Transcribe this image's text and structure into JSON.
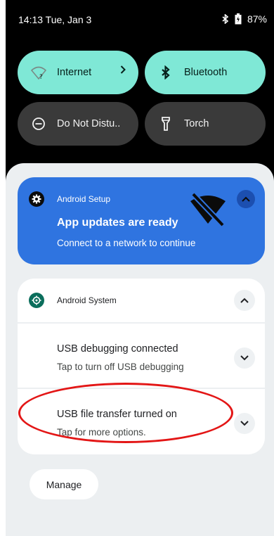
{
  "status_bar": {
    "time": "14:13 Tue, Jan 3",
    "battery_percent": "87%",
    "icons": [
      "bluetooth-icon",
      "battery-icon"
    ]
  },
  "quick_settings": {
    "tiles": [
      {
        "label": "Internet",
        "icon": "wifi-question-icon",
        "state": "on"
      },
      {
        "label": "Bluetooth",
        "icon": "bluetooth-icon",
        "state": "on"
      },
      {
        "label": "Do Not Distu..",
        "icon": "do-not-disturb-icon",
        "state": "off"
      },
      {
        "label": "Torch",
        "icon": "flashlight-icon",
        "state": "off"
      }
    ]
  },
  "notifications": {
    "setup": {
      "app_name": "Android Setup",
      "title": "App updates are ready",
      "text": "Connect to a network to continue",
      "icon": "wifi-off-icon"
    },
    "system": {
      "app_name": "Android System",
      "items": [
        {
          "title": "USB debugging connected",
          "text": "Tap to turn off USB debugging"
        },
        {
          "title": "USB file transfer turned on",
          "text": "Tap for more options."
        }
      ]
    }
  },
  "manage_label": "Manage",
  "colors": {
    "tile_on": "#7FE8D6",
    "tile_off": "#3a3a3a",
    "setup_card": "#2f74e0",
    "annotation": "#e31616"
  }
}
